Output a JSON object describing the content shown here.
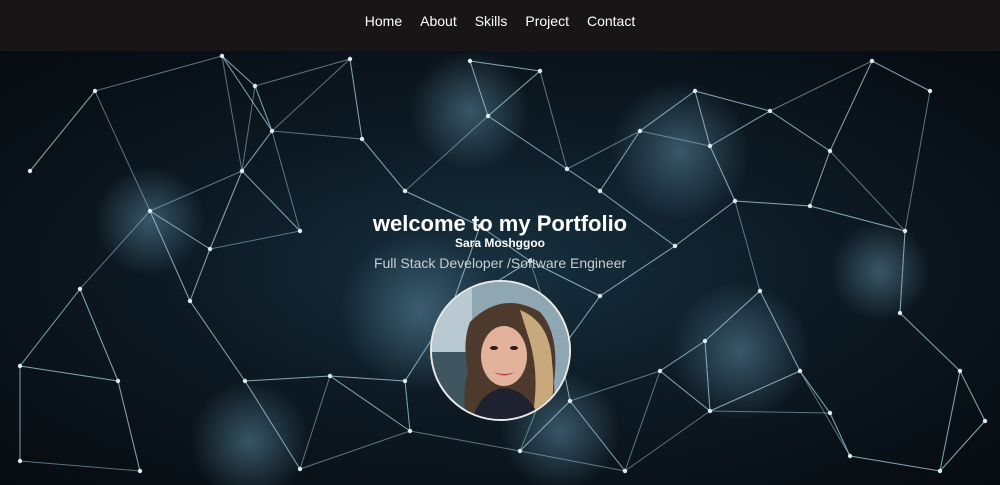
{
  "nav": {
    "items": [
      {
        "label": "Home"
      },
      {
        "label": "About"
      },
      {
        "label": "Skills"
      },
      {
        "label": "Project"
      },
      {
        "label": "Contact"
      }
    ]
  },
  "hero": {
    "title": "welcome to my Portfolio",
    "name": "Sara Moshggoo",
    "role": "Full Stack Developer /Software Engineer"
  },
  "colors": {
    "navbar_bg": "#171515",
    "network_line": "#9fc4d6",
    "network_node": "#dfeaf0"
  }
}
